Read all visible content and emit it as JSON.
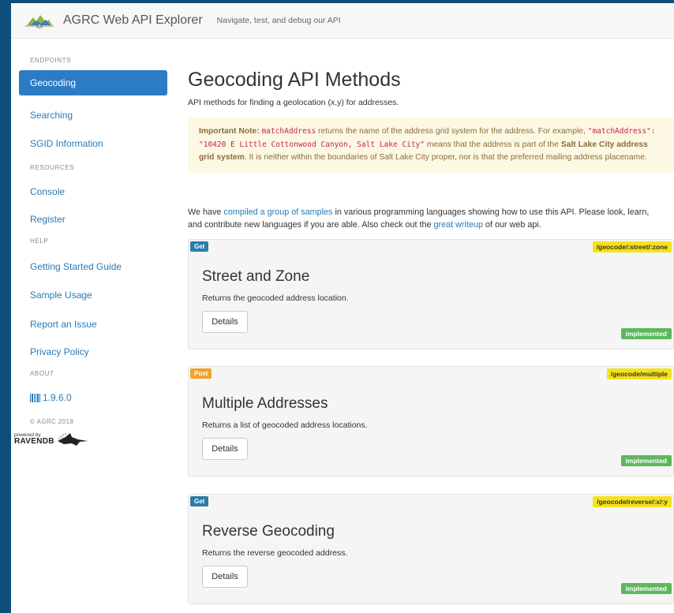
{
  "header": {
    "brand": "AGRC Web API Explorer",
    "tagline": "Navigate, test, and debug our API",
    "logo_icon": "mountain-logo-icon"
  },
  "sidebar": {
    "endpoints_heading": "ENDPOINTS",
    "endpoints": [
      {
        "label": "Geocoding",
        "active": true
      },
      {
        "label": "Searching"
      },
      {
        "label": "SGID Information"
      }
    ],
    "resources_heading": "RESOURCES",
    "resources": [
      {
        "label": "Console"
      },
      {
        "label": "Register"
      }
    ],
    "help_heading": "HELP",
    "help": [
      {
        "label": "Getting Started Guide"
      },
      {
        "label": "Sample Usage"
      },
      {
        "label": "Report an Issue"
      },
      {
        "label": "Privacy Policy"
      }
    ],
    "about_heading": "ABOUT",
    "version": "1.9.6.0",
    "copyright": "© AGRC 2018",
    "powered_by": "powered by",
    "ravendb": "RAVENDB"
  },
  "main": {
    "title": "Geocoding API Methods",
    "subtitle": "API methods for finding a geolocation (x,y) for addresses.",
    "note": {
      "label": "Important Note:",
      "code1": "matchAddress",
      "text1": " returns the name of the address grid system for the address. For example, ",
      "code2": "\"matchAddress\": \"10420 E Little Cottonwood Canyon, Salt Lake City\"",
      "text2": " means that the address is part of the ",
      "bold": "Salt Lake City address grid system",
      "text3": ". It is neither within the boundaries of Salt Lake City proper, nor is that the preferred mailing address placename."
    },
    "intro": {
      "t1": "We have ",
      "link1": "compiled a group of samples",
      "t2": " in various programming languages showing how to use this API. Please look, learn, and contribute new languages if you are able. Also check out the ",
      "link2": "great writeup",
      "t3": " of our web api."
    },
    "cards": [
      {
        "method": "Get",
        "route": "/geocode/:street/:zone",
        "title": "Street and Zone",
        "desc": "Returns the geocoded address location.",
        "button": "Details",
        "status": "implemented"
      },
      {
        "method": "Post",
        "route": "/geocode/multiple",
        "title": "Multiple Addresses",
        "desc": "Returns a list of geocoded address locations.",
        "button": "Details",
        "status": "implemented"
      },
      {
        "method": "Get",
        "route": "/geocode/reverse/:x/:y",
        "title": "Reverse Geocoding",
        "desc": "Returns the reverse geocoded address.",
        "button": "Details",
        "status": "implemented"
      }
    ]
  },
  "colors": {
    "page_frame": "#0d4e7a",
    "active_nav": "#2c7cc4",
    "link": "#2a7ab5",
    "get_badge": "#2b7ca7",
    "post_badge": "#f0a230",
    "route_badge": "#f5e21a",
    "implemented_badge": "#5cb85c",
    "note_bg": "#fcf8e3"
  }
}
